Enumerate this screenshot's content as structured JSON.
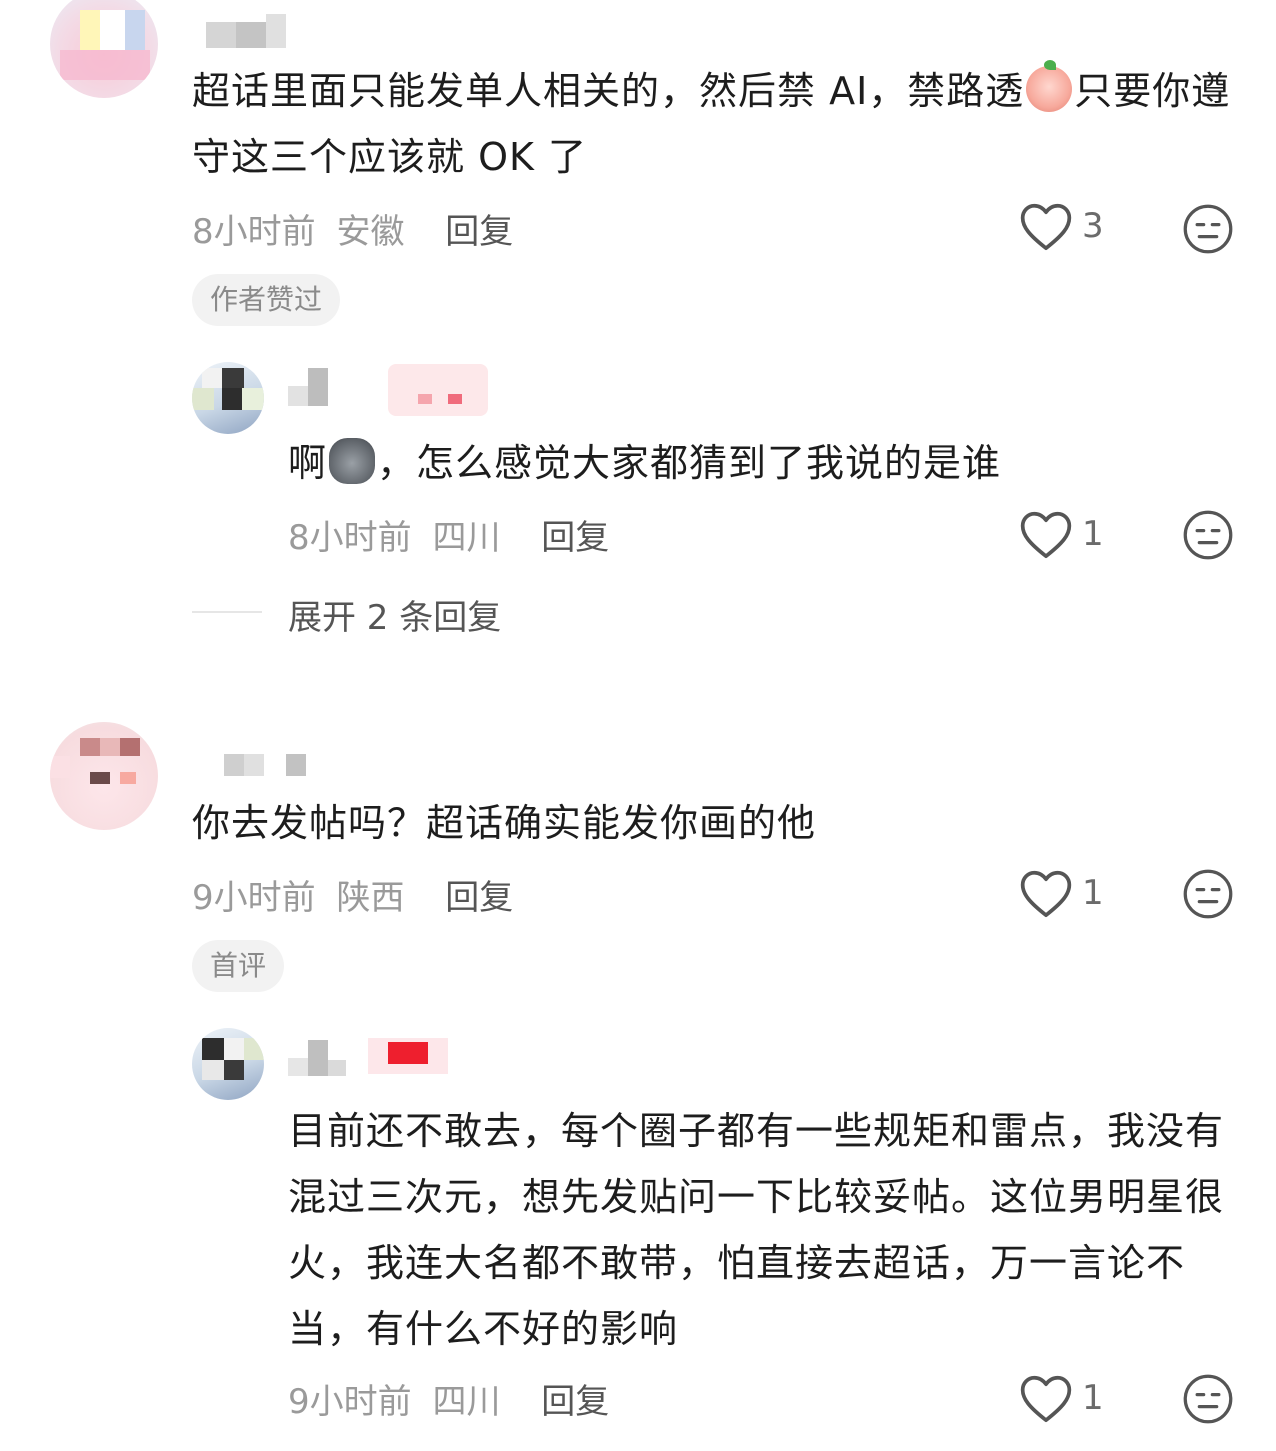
{
  "comments": [
    {
      "text_a": "超话里面只能发单人相关的，然后禁 AI，禁路透",
      "emoji": "pray-peach-emoji",
      "text_b": "只要你遵守这三个应该就 OK 了",
      "time": "8小时前",
      "location": "安徽",
      "reply_label": "回复",
      "likes": "3",
      "tag": "作者赞过"
    },
    {
      "text_a": "啊",
      "emoji": "cat-emoji",
      "text_b": "，怎么感觉大家都猜到了我说的是谁",
      "time": "8小时前",
      "location": "四川",
      "reply_label": "回复",
      "likes": "1",
      "expand_label": "展开 2 条回复"
    },
    {
      "text": "你去发帖吗？超话确实能发你画的他",
      "time": "9小时前",
      "location": "陕西",
      "reply_label": "回复",
      "likes": "1",
      "tag": "首评"
    },
    {
      "text": "目前还不敢去，每个圈子都有一些规矩和雷点，我没有混过三次元，想先发贴问一下比较妥帖。这位男明星很火，我连大名都不敢带，怕直接去超话，万一言论不当，有什么不好的影响",
      "time": "9小时前",
      "location": "四川",
      "reply_label": "回复",
      "likes": "1"
    }
  ],
  "icons": {
    "like": "heart-outline-icon",
    "react": "meh-face-icon"
  },
  "colors": {
    "text_primary": "#1d1d1d",
    "text_meta": "#9a9a9a",
    "tag_bg": "#f2f2f2"
  }
}
